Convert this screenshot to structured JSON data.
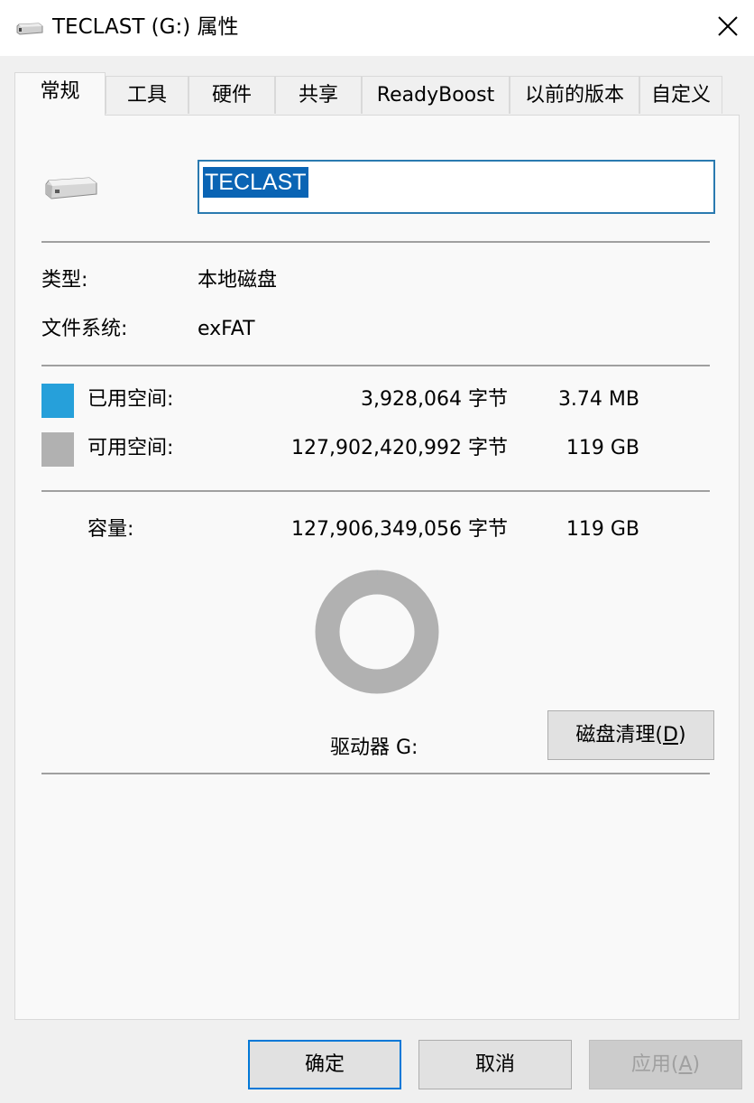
{
  "window": {
    "title": "TECLAST (G:) 属性",
    "close_icon": "close-icon"
  },
  "tabs": [
    {
      "label": "常规",
      "active": true
    },
    {
      "label": "工具",
      "active": false
    },
    {
      "label": "硬件",
      "active": false
    },
    {
      "label": "共享",
      "active": false
    },
    {
      "label": "ReadyBoost",
      "active": false
    },
    {
      "label": "以前的版本",
      "active": false
    },
    {
      "label": "自定义",
      "active": false
    }
  ],
  "general": {
    "drive_name": "TECLAST",
    "type_label": "类型:",
    "type_value": "本地磁盘",
    "fs_label": "文件系统:",
    "fs_value": "exFAT",
    "used": {
      "label": "已用空间:",
      "bytes": "3,928,064 字节",
      "size": "3.74 MB",
      "color": "#26a0da"
    },
    "free": {
      "label": "可用空间:",
      "bytes": "127,902,420,992 字节",
      "size": "119 GB",
      "color": "#b1b1b1"
    },
    "capacity": {
      "label": "容量:",
      "bytes": "127,906,349,056 字节",
      "size": "119 GB"
    },
    "usage_fraction": 3.07e-05,
    "drive_label": "驱动器 G:",
    "cleanup_button": {
      "text": "磁盘清理(",
      "key": "D",
      "suffix": ")"
    }
  },
  "footer": {
    "ok_label": "确定",
    "cancel_label": "取消",
    "apply": {
      "text": "应用(",
      "key": "A",
      "suffix": ")"
    }
  }
}
